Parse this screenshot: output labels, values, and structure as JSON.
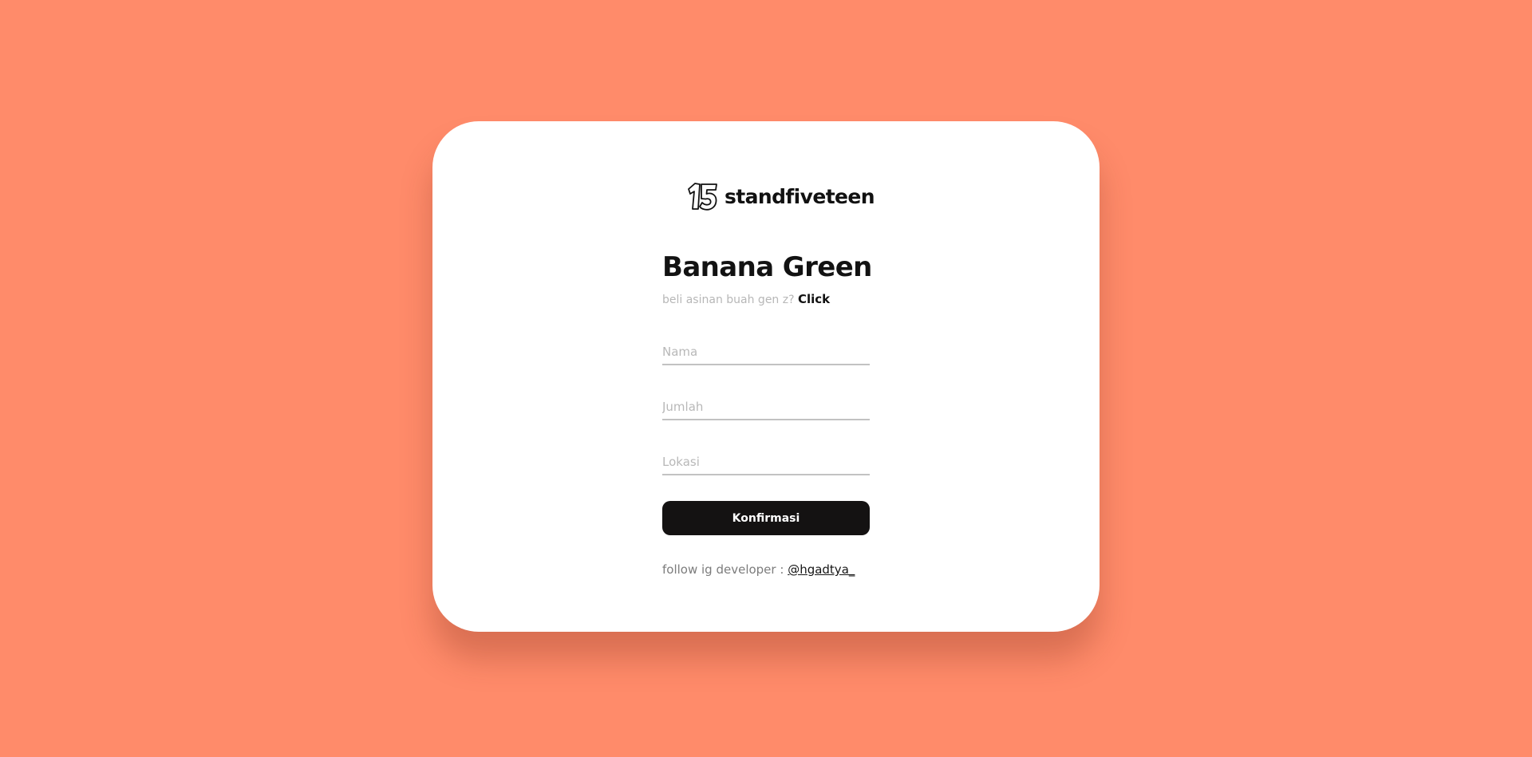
{
  "brand": {
    "logo_text": "15",
    "name": "standfiveteen"
  },
  "form": {
    "title": "Banana Green",
    "subtitle_text": "beli asinan buah gen z?",
    "subtitle_link": "Click",
    "fields": {
      "name_placeholder": "Nama",
      "quantity_placeholder": "Jumlah",
      "location_placeholder": "Lokasi"
    },
    "submit_label": "Konfirmasi"
  },
  "footer": {
    "text": "follow ig developer :",
    "link": "@hgadtya_"
  },
  "colors": {
    "background": "#ff8b6a",
    "card": "#ffffff",
    "button": "#141212",
    "text_dark": "#121212"
  }
}
